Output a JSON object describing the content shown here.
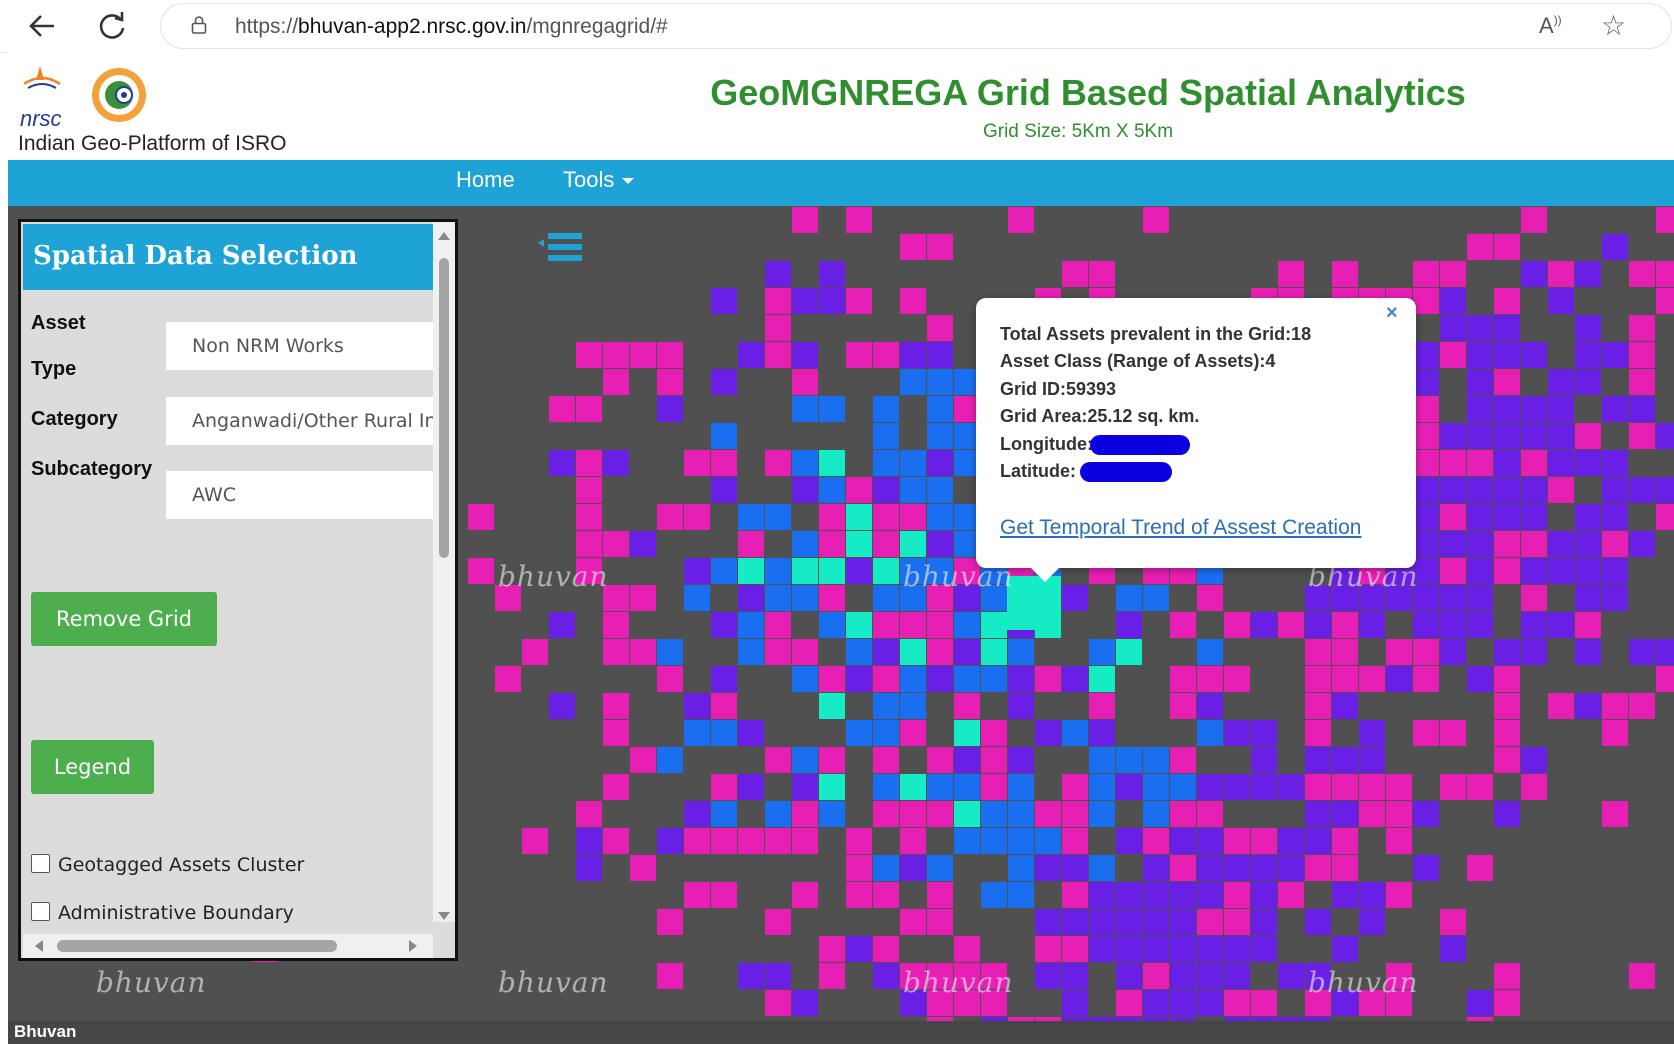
{
  "browser": {
    "url_prefix": "https://",
    "url_host": "bhuvan-app2.nrsc.gov.in",
    "url_path": "/mgnregagrid/#",
    "icons": [
      "back-arrow-icon",
      "reload-icon",
      "lock-icon",
      "read-aloud-icon",
      "favorite-star-icon"
    ]
  },
  "header": {
    "logo_text_small": "इसरो isro",
    "logo_text": "nrsc",
    "platform_label": "Indian Geo-Platform of ISRO",
    "title": "GeoMGNREGA Grid Based Spatial Analytics",
    "subtitle": "Grid Size: 5Km X 5Km"
  },
  "nav": {
    "home": "Home",
    "tools": "Tools"
  },
  "panel": {
    "title": "Spatial Data Selection",
    "asset_label": "Asset",
    "type_label": "Type",
    "asset_type_value": "Non NRM Works",
    "category_label": "Category",
    "category_value": "Anganwadi/Other Rural Infrastructure",
    "subcategory_label": "Subcategory",
    "subcategory_value": "AWC",
    "remove_grid_label": "Remove Grid",
    "legend_label": "Legend",
    "checkbox_geotagged": "Geotagged Assets Cluster",
    "checkbox_admin": "Administrative Boundary"
  },
  "popup": {
    "close_symbol": "×",
    "total_assets": "Total Assets prevalent in the Grid:18",
    "asset_class": "Asset Class (Range of Assets):4",
    "grid_id": "Grid ID:59393",
    "grid_area": "Grid Area:25.12 sq. km.",
    "longitude_label": "Longitude:",
    "latitude_label": "Latitude:",
    "link_text": "Get Temporal Trend of Assest Creation"
  },
  "map": {
    "watermark": "bhuvan",
    "footer_label": "Bhuvan",
    "colors": {
      "background": "#505050",
      "magenta": "#e81fb4",
      "purple": "#6a1fe6",
      "blue": "#1a6ff0",
      "cyan": "#15ecc6"
    }
  }
}
